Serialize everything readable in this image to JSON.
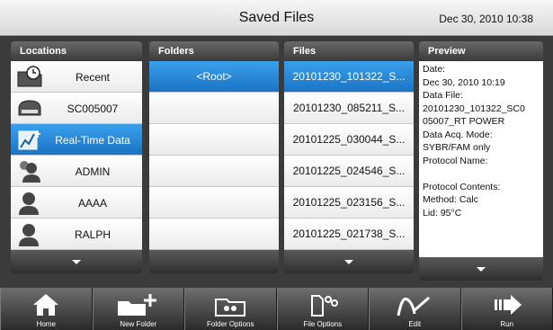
{
  "header": {
    "title": "Saved Files",
    "datetime": "Dec 30, 2010 10:38"
  },
  "locations": {
    "heading": "Locations",
    "items": [
      {
        "label": "Recent",
        "icon": "recent-folder-icon",
        "selected": false
      },
      {
        "label": "SC005007",
        "icon": "instrument-icon",
        "selected": false
      },
      {
        "label": "Real-Time Data",
        "icon": "realtime-data-icon",
        "selected": true
      },
      {
        "label": "ADMIN",
        "icon": "admin-user-icon",
        "selected": false
      },
      {
        "label": "AAAA",
        "icon": "user-icon",
        "selected": false
      },
      {
        "label": "RALPH",
        "icon": "user-icon",
        "selected": false
      }
    ]
  },
  "folders": {
    "heading": "Folders",
    "items": [
      "<Root>",
      "",
      "",
      "",
      "",
      ""
    ]
  },
  "files": {
    "heading": "Files",
    "items": [
      "20101230_101322_S...",
      "20101230_085211_S...",
      "20101225_030044_S...",
      "20101225_024546_S...",
      "20101225_023156_S...",
      "20101225_021738_S..."
    ]
  },
  "preview": {
    "heading": "Preview",
    "lines": [
      "Date:",
      "Dec 30, 2010 10:19",
      "Data File:",
      "20101230_101322_SC0",
      "05007_RT POWER",
      "Data Acq. Mode:",
      "SYBR/FAM only",
      "Protocol Name:",
      "",
      "Protocol Contents:",
      "Method: Calc",
      "Lid: 95°C"
    ]
  },
  "toolbar": {
    "home": "Home",
    "new_folder": "New Folder",
    "folder_options": "Folder Options",
    "file_options": "File Options",
    "edit": "Edit",
    "run": "Run"
  },
  "colors": {
    "selected": "#1f7ccc",
    "frame": "#3b3b3b"
  }
}
